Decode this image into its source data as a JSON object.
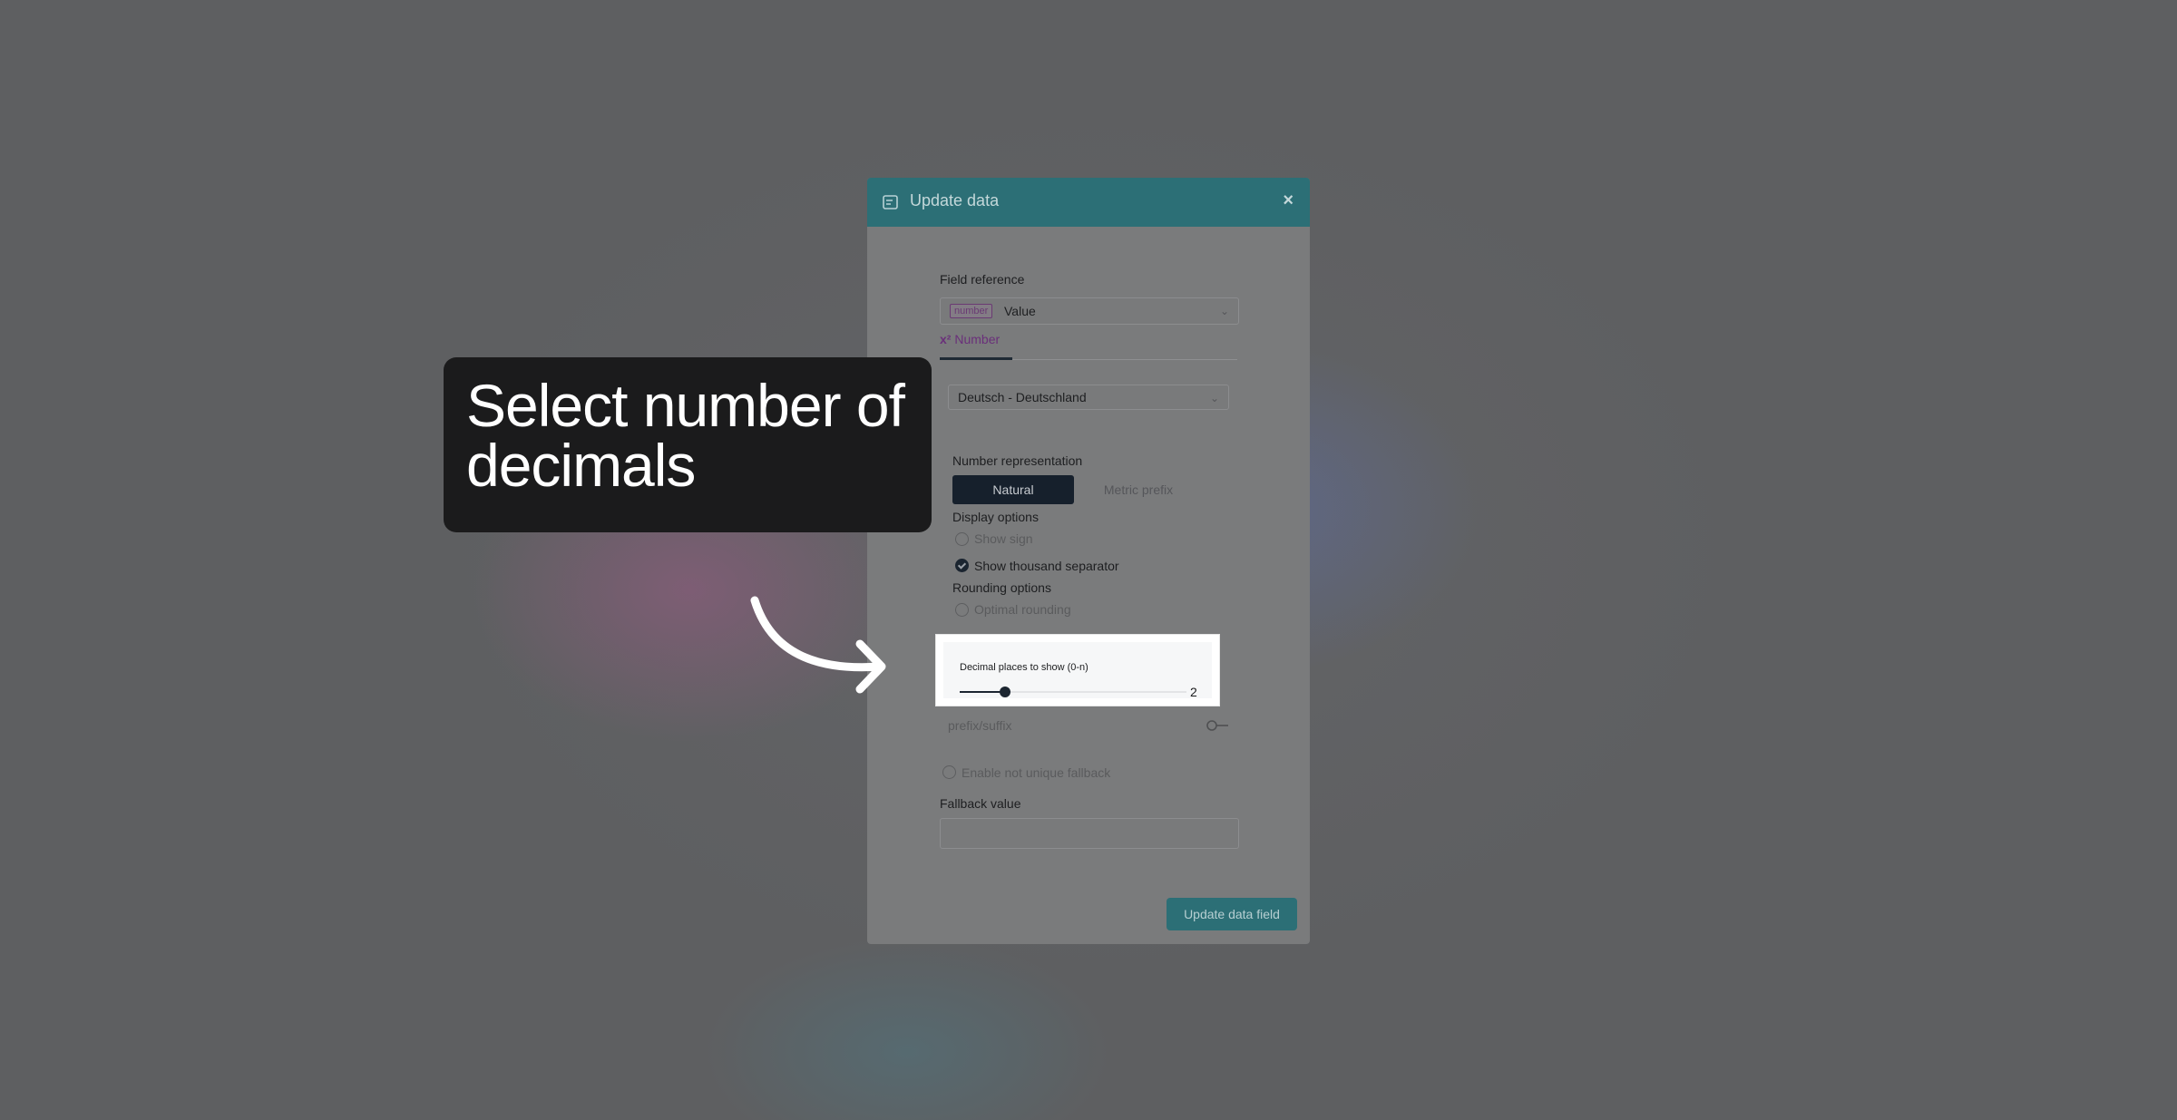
{
  "dialog": {
    "title": "Update data",
    "close_label": "×",
    "field_reference": {
      "label": "Field reference",
      "type_badge": "number",
      "value": "Value"
    },
    "tab_icon": "x²",
    "tab_label": "Number",
    "locale_value": "Deutsch - Deutschland",
    "number_representation": {
      "label": "Number representation",
      "options": [
        "Natural",
        "Metric prefix"
      ],
      "selected": "Natural"
    },
    "display_options": {
      "label": "Display options",
      "show_sign": "Show sign",
      "show_thousand_separator": "Show thousand separator",
      "show_thousand_separator_checked": true
    },
    "rounding_options": {
      "label": "Rounding options",
      "optimal_rounding": "Optimal rounding"
    },
    "decimal_places": {
      "label": "Decimal places to show (0-n)",
      "value": "2",
      "level_fraction": 0.2
    },
    "prefix_suffix_label": "prefix/suffix",
    "not_unique_fallback_label": "Enable not unique fallback",
    "fallback_value_label": "Fallback value",
    "fallback_value": "",
    "submit_label": "Update data field"
  },
  "callout": {
    "line1": "Select number of",
    "line2": "decimals"
  },
  "colors": {
    "header": "#2c6f76",
    "accent_dark": "#16202c",
    "tab_accent": "#6a2f7a",
    "callout_bg": "#1b1b1c"
  }
}
